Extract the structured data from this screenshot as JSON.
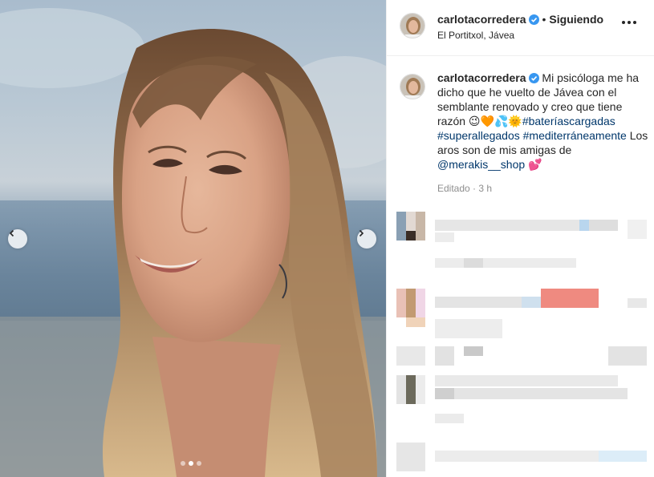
{
  "post": {
    "username": "carlotacorredera",
    "separator": "•",
    "following_label": "Siguiendo",
    "location": "El Portitxol, Jávea",
    "caption": {
      "username": "carlotacorredera",
      "text_before": "Mi psicóloga me ha dicho que he vuelto de Jávea con el semblante renovado y creo que tiene razón ",
      "emojis_1": "😉🧡💦🌞",
      "hashtag_1": "#bateríascargadas",
      "hashtag_2": "#superallegados",
      "hashtag_3": "#mediterráneamente",
      "text_after": " Los aros son de mis amigas de ",
      "mention": "@merakis__shop",
      "emoji_2": "💕"
    },
    "edited_label": "Editado",
    "time_sep": "·",
    "time_ago": "3 h"
  },
  "carousel": {
    "slide_count": 3,
    "active_slide": 2
  },
  "icons": {
    "verified": "verified-badge-icon",
    "more": "more-options-icon",
    "prev": "chevron-left-icon",
    "next": "chevron-right-icon"
  },
  "colors": {
    "link": "#00376b",
    "verified": "#3897f0",
    "muted": "#8e8e8e"
  }
}
